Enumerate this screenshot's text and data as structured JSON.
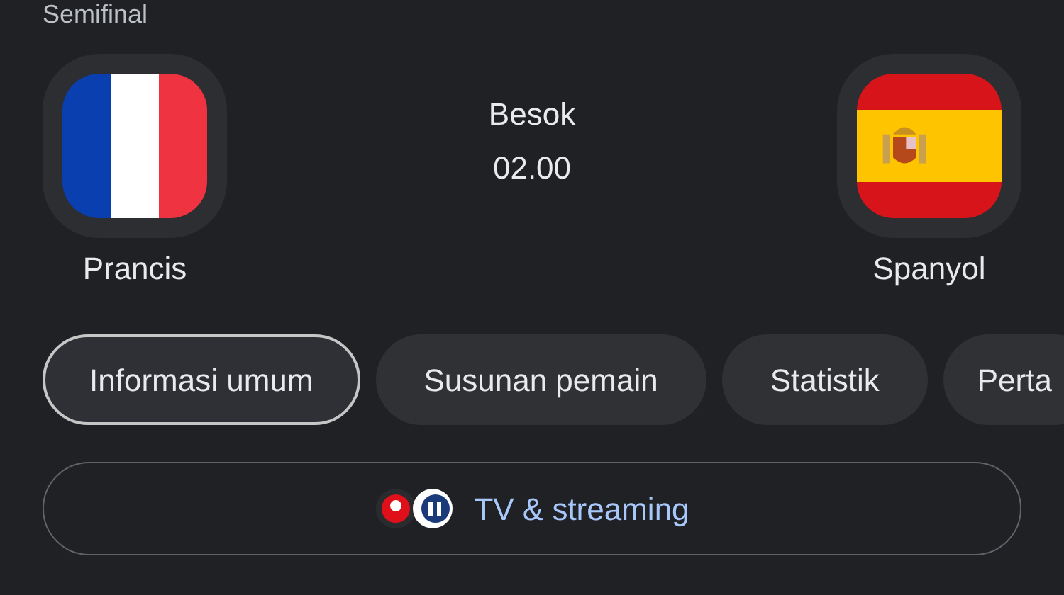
{
  "stage": "Semifinal",
  "match": {
    "day": "Besok",
    "time": "02.00"
  },
  "teams": [
    {
      "name": "Prancis",
      "kind": "france"
    },
    {
      "name": "Spanyol",
      "kind": "spain"
    }
  ],
  "tabs": [
    {
      "label": "Informasi umum",
      "selected": true
    },
    {
      "label": "Susunan pemain",
      "selected": false
    },
    {
      "label": "Statistik",
      "selected": false
    },
    {
      "label": "Perta",
      "selected": false
    }
  ],
  "tv_button": {
    "label": "TV & streaming"
  }
}
